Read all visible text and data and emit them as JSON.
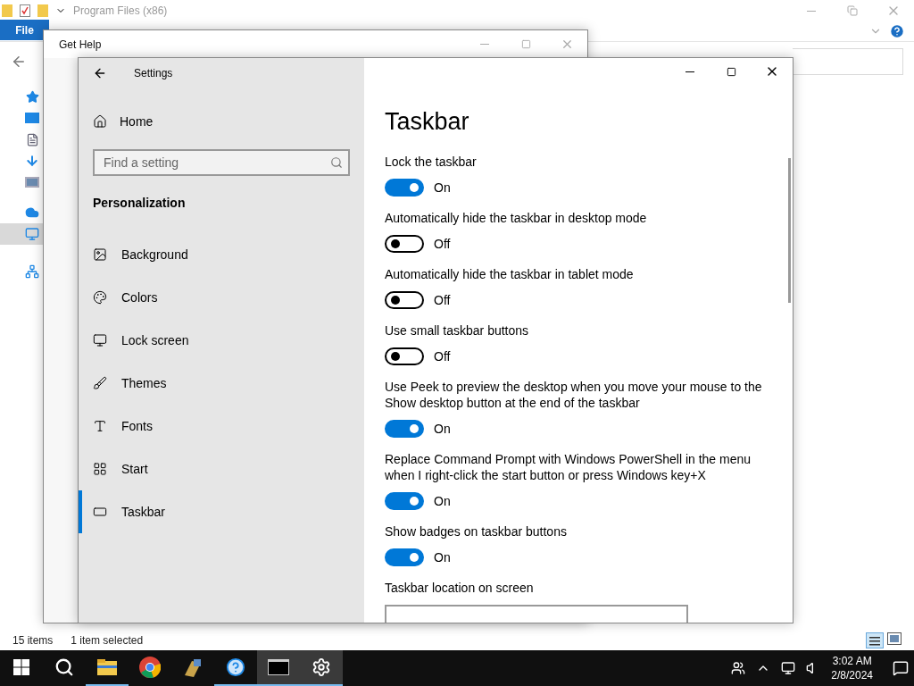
{
  "explorer": {
    "title": "Program Files (x86)",
    "file_tab": "File",
    "nav_icons": [
      {
        "kind": "star",
        "selected": false
      },
      {
        "kind": "desktop",
        "selected": false
      },
      {
        "kind": "document",
        "selected": false
      },
      {
        "kind": "download",
        "selected": false
      },
      {
        "kind": "pictures",
        "selected": false
      },
      {
        "kind": "cloud",
        "selected": false
      },
      {
        "kind": "computer",
        "selected": true
      },
      {
        "kind": "network",
        "selected": false
      }
    ],
    "status_count": "15 items",
    "status_selection": "1 item selected"
  },
  "get_help": {
    "title": "Get Help"
  },
  "settings": {
    "title": "Settings",
    "home": "Home",
    "search_placeholder": "Find a setting",
    "section": "Personalization",
    "nav": [
      {
        "label": "Background",
        "kind": "image",
        "selected": false
      },
      {
        "label": "Colors",
        "kind": "palette",
        "selected": false
      },
      {
        "label": "Lock screen",
        "kind": "monitor",
        "selected": false
      },
      {
        "label": "Themes",
        "kind": "brush",
        "selected": false
      },
      {
        "label": "Fonts",
        "kind": "type",
        "selected": false
      },
      {
        "label": "Start",
        "kind": "grid",
        "selected": false
      },
      {
        "label": "Taskbar",
        "kind": "taskbar",
        "selected": true
      }
    ],
    "page_title": "Taskbar",
    "toggles": [
      {
        "label": "Lock the taskbar",
        "on": true,
        "state_text": "On"
      },
      {
        "label": "Automatically hide the taskbar in desktop mode",
        "on": false,
        "state_text": "Off"
      },
      {
        "label": "Automatically hide the taskbar in tablet mode",
        "on": false,
        "state_text": "Off"
      },
      {
        "label": "Use small taskbar buttons",
        "on": false,
        "state_text": "Off"
      },
      {
        "label": "Use Peek to preview the desktop when you move your mouse to the Show desktop button at the end of the taskbar",
        "on": true,
        "state_text": "On"
      },
      {
        "label": "Replace Command Prompt with Windows PowerShell in the menu when I right-click the start button or press Windows key+X",
        "on": true,
        "state_text": "On"
      },
      {
        "label": "Show badges on taskbar buttons",
        "on": true,
        "state_text": "On"
      }
    ],
    "dropdown_label": "Taskbar location on screen"
  },
  "taskbar": {
    "apps": [
      {
        "kind": "explorer",
        "running": true,
        "selected": false
      },
      {
        "kind": "chrome",
        "running": false,
        "selected": false
      },
      {
        "kind": "tool",
        "running": false,
        "selected": false
      },
      {
        "kind": "help",
        "running": true,
        "selected": false
      },
      {
        "kind": "console",
        "running": true,
        "selected": true
      },
      {
        "kind": "settings",
        "running": true,
        "selected": true
      }
    ],
    "time": "3:02 AM",
    "date": "2/8/2024"
  }
}
